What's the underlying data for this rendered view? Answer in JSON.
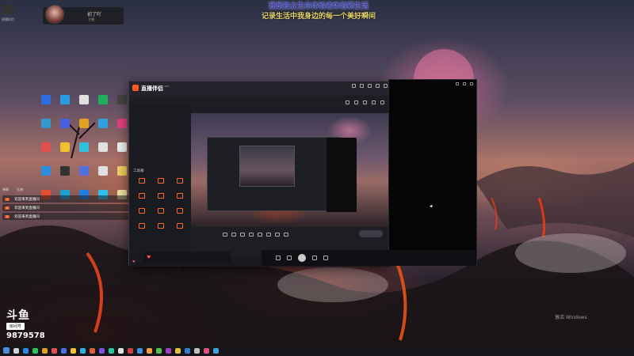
{
  "overlay": {
    "top_text_line1": "我是独立生命体验者体验新生活",
    "top_text_line2": "记录生活中我身边的每一个美好瞬间"
  },
  "user_card": {
    "name": "初了吖",
    "sub": "主播"
  },
  "corner": {
    "label": "直播伴侣"
  },
  "desktop_icons": [
    {
      "label": "",
      "color": "#2f6ee0"
    },
    {
      "label": "",
      "color": "#2a9be0"
    },
    {
      "label": "",
      "color": "#e0e0e0"
    },
    {
      "label": "",
      "color": "#20b060"
    },
    {
      "label": "",
      "color": "#444"
    },
    {
      "label": "",
      "color": "#39c"
    },
    {
      "label": "",
      "color": "#4a5ee0"
    },
    {
      "label": "",
      "color": "#e0a020"
    },
    {
      "label": "",
      "color": "#30a0e0"
    },
    {
      "label": "",
      "color": "#e04080"
    },
    {
      "label": "",
      "color": "#e05050"
    },
    {
      "label": "",
      "color": "#f0c030"
    },
    {
      "label": "",
      "color": "#30c0e0"
    },
    {
      "label": "",
      "color": "#e0e0e0"
    },
    {
      "label": "",
      "color": "#f0f0f0"
    },
    {
      "label": "",
      "color": "#2f8be0"
    },
    {
      "label": "",
      "color": "#333"
    },
    {
      "label": "",
      "color": "#5070e0"
    },
    {
      "label": "",
      "color": "#e0e0e0"
    },
    {
      "label": "",
      "color": "#f0d060"
    },
    {
      "label": "",
      "color": "#e05030"
    },
    {
      "label": "",
      "color": "#20a0d0"
    },
    {
      "label": "",
      "color": "#2080e0"
    },
    {
      "label": "",
      "color": "#30c0f0"
    },
    {
      "label": "",
      "color": "#f0e0a0"
    }
  ],
  "chat": {
    "messages": [
      {
        "badge": "1",
        "name": "",
        "text": "欢迎来到直播间"
      },
      {
        "badge": "2",
        "name": "",
        "text": "欢迎来到直播间"
      },
      {
        "badge": "3",
        "name": "",
        "text": "欢迎来到直播间"
      }
    ]
  },
  "notice": {
    "block1": "",
    "block2": ""
  },
  "douyu": {
    "logo": "斗鱼",
    "room_label": "房间号",
    "room_number": "9879578"
  },
  "app": {
    "brand": "直播伴侣",
    "version": "",
    "room_title": "",
    "tabs": [
      "",
      "",
      ""
    ],
    "toolbox_title": "工具箱",
    "tools": [
      "",
      "",
      "",
      "",
      "",
      "",
      "",
      "",
      "",
      "",
      "",
      ""
    ],
    "bottom_actions": [
      "",
      "",
      "",
      "",
      "",
      "",
      "",
      ""
    ],
    "start_label": "",
    "status": ""
  },
  "media": {
    "text": "",
    "highlight": ""
  },
  "chip": {
    "text": ""
  },
  "windows_activation": {
    "title": "激活 Windows",
    "sub": ""
  },
  "tray": {
    "time": "",
    "date": ""
  }
}
